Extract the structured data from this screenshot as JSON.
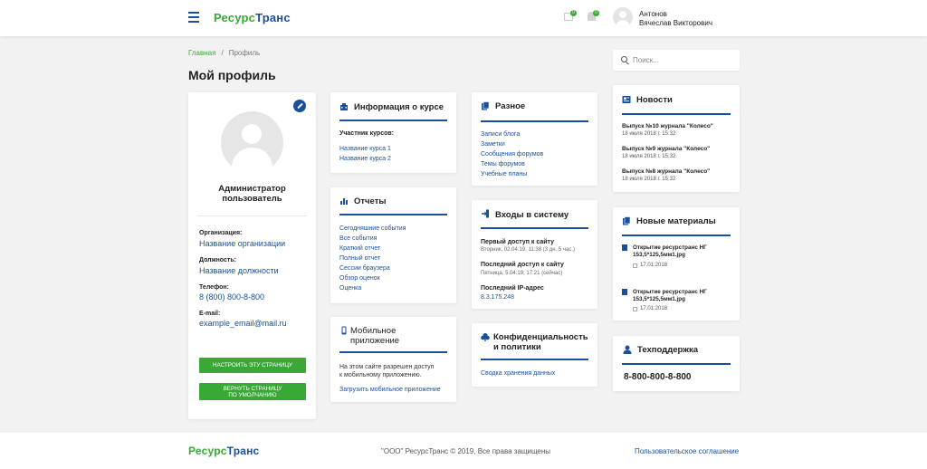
{
  "header": {
    "logo_part1": "Ресурс",
    "logo_part2": "Транс",
    "messages_count": "0",
    "notifications_count": "0",
    "user_last_name": "Антонов",
    "user_first_name": "Вячеслав Викторович"
  },
  "breadcrumb": {
    "home": "Главная",
    "separator": "/",
    "current": "Профиль"
  },
  "page_title": "Мой профиль",
  "search": {
    "placeholder": "Поиск..."
  },
  "profile": {
    "name_line1": "Администратор",
    "name_line2": "пользователь",
    "org_label": "Организация:",
    "org_value": "Название организации",
    "position_label": "Должность:",
    "position_value": "Название должности",
    "phone_label": "Телефон:",
    "phone_value": "8 (800) 800-8-800",
    "email_label": "E-mail:",
    "email_value": "example_email@mail.ru",
    "btn_configure": "НАСТРОИТЬ ЭТУ СТРАНИЦУ",
    "btn_reset_line1": "ВЕРНУТЬ СТРАНИЦУ",
    "btn_reset_line2": "ПО УМОЛЧАНИЮ"
  },
  "course_info": {
    "title": "Информация о курсе",
    "participant_label": "Участник курсов:",
    "courses": [
      "Название курса 1",
      "Название курса 2"
    ]
  },
  "reports": {
    "title": "Отчеты",
    "items": [
      "Сегодняшние события",
      "Все события",
      "Краткий отчет",
      "Полный отчет",
      "Сессии браузера",
      "Обзор оценок",
      "Оценка"
    ]
  },
  "mobile": {
    "title_line1": "Мобильное",
    "title_line2": "приложение",
    "text_line1": "На этом сайте разрешен доступ",
    "text_line2": "к мобильному приложению.",
    "download": "Загрузить мобильное приложение"
  },
  "misc": {
    "title": "Разное",
    "items": [
      "Записи блога",
      "Заметки",
      "Сообщения форумов",
      "Темы форумов",
      "Учебные планы"
    ]
  },
  "logins": {
    "title": "Входы в систему",
    "first_label": "Первый доступ к сайту",
    "first_value": "Вторник, 02.04.19, 11:38 (3 дн. 5 час.)",
    "last_label": "Последний доступ к сайту",
    "last_value": "Пятница, 5.04.19, 17:21 (сейчас)",
    "ip_label": "Последний IP-адрес",
    "ip_value": "8.3.175.248"
  },
  "privacy": {
    "title_line1": "Конфиденциальность",
    "title_line2": "и политики",
    "link": "Сводка хранения данных"
  },
  "news": {
    "title": "Новости",
    "items": [
      {
        "title": "Выпуск №10 журнала \"Колесо\"",
        "date": "18 июля 2018 г. 15:32"
      },
      {
        "title": "Выпуск №9 журнала \"Колесо\"",
        "date": "18 июля 2018 г. 15:32"
      },
      {
        "title": "Выпуск №8 журнала \"Колесо\"",
        "date": "18 июля 2018 г. 15:32"
      }
    ]
  },
  "materials": {
    "title": "Новые материалы",
    "items": [
      {
        "line1": "Открытие ресурстранс НГ",
        "line2": "153,5*125,5мм1.jpg",
        "date": "17.01.2018"
      },
      {
        "line1": "Открытие ресурстранс НГ",
        "line2": "153,5*125,5мм1.jpg",
        "date": "17.01.2018"
      }
    ]
  },
  "support": {
    "title": "Техподдержка",
    "phone": "8-800-800-8-800"
  },
  "footer": {
    "copyright": "\"ООО\" РесурсТранс © 2019, Все права защищены",
    "agreement": "Пользовательское соглашение"
  },
  "colors": {
    "brand_blue": "#1a4f9c",
    "brand_green": "#39a935",
    "background": "#f2f2f2"
  }
}
